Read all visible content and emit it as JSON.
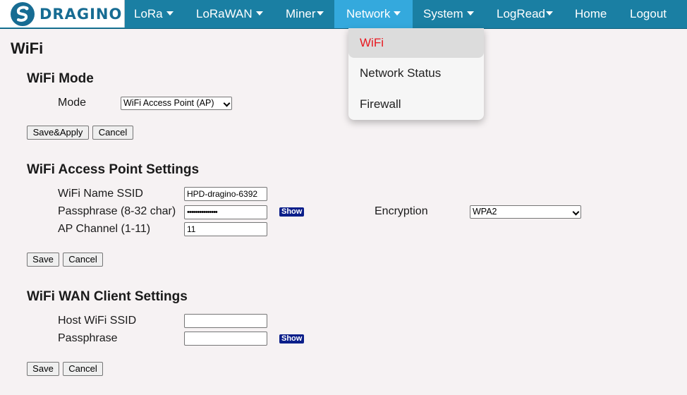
{
  "brand": {
    "name": "DRAGINO"
  },
  "nav": {
    "items": [
      {
        "label": "LoRa",
        "caret": true
      },
      {
        "label": "LoRaWAN",
        "caret": true
      },
      {
        "label": "Miner",
        "caret": true
      },
      {
        "label": "Network",
        "caret": true,
        "active": true
      },
      {
        "label": "System",
        "caret": true
      },
      {
        "label": "LogRead",
        "caret": true
      },
      {
        "label": "Home",
        "caret": false
      },
      {
        "label": "Logout",
        "caret": false
      }
    ],
    "active_color": "#34a9dd",
    "bar_color": "#1a7fa3"
  },
  "network_menu": {
    "items": [
      {
        "label": "WiFi",
        "selected": true
      },
      {
        "label": "Network Status"
      },
      {
        "label": "Firewall"
      }
    ],
    "selected_color": "#e8181f"
  },
  "page": {
    "title": "WiFi"
  },
  "wifi_mode": {
    "title": "WiFi Mode",
    "mode_label": "Mode",
    "mode_value": "WiFi Access Point (AP)",
    "save_apply_label": "Save&Apply",
    "cancel_label": "Cancel"
  },
  "ap_settings": {
    "title": "WiFi Access Point Settings",
    "ssid_label": "WiFi Name SSID",
    "ssid_value": "HPD-dragino-6392",
    "passphrase_label": "Passphrase (8-32 char)",
    "passphrase_value": "•••••••••••••••",
    "show_label": "Show",
    "encryption_label": "Encryption",
    "encryption_value": "WPA2",
    "channel_label": "AP Channel (1-11)",
    "channel_value": "11",
    "save_label": "Save",
    "cancel_label": "Cancel"
  },
  "wan_client": {
    "title": "WiFi WAN Client Settings",
    "host_ssid_label": "Host WiFi SSID",
    "host_ssid_value": "",
    "passphrase_label": "Passphrase",
    "passphrase_value": "",
    "show_label": "Show",
    "save_label": "Save",
    "cancel_label": "Cancel"
  }
}
